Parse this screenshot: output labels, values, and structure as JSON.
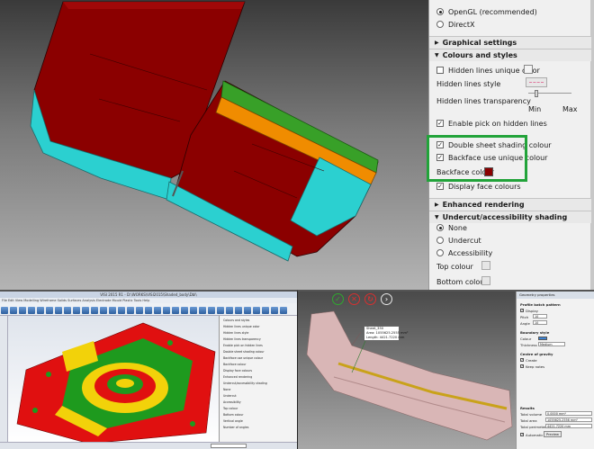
{
  "display": {
    "renderer_options": [
      {
        "label": "OpenGL (recommended)",
        "selected": true
      },
      {
        "label": "DirectX",
        "selected": false
      }
    ]
  },
  "sections": {
    "graphical": "Graphical settings",
    "colours": "Colours and styles",
    "enhanced": "Enhanced rendering",
    "undercut": "Undercut/accessibility shading"
  },
  "colours": {
    "hidden_unique": {
      "label": "Hidden lines unique color",
      "checked": false
    },
    "hidden_style": "Hidden lines style",
    "hidden_transparency": "Hidden lines transparency",
    "slider_min": "Min",
    "slider_max": "Max",
    "slider_value": 0.15,
    "pick_hidden": {
      "label": "Enable pick on hidden lines",
      "checked": true
    },
    "double_sheet": {
      "label": "Double sheet shading colour",
      "checked": true
    },
    "backface_unique": {
      "label": "Backface use unique colour",
      "checked": true
    },
    "backface_colour_label": "Backface colour",
    "backface_colour": "#8b0000",
    "display_face": {
      "label": "Display face colours",
      "checked": true
    }
  },
  "undercut": {
    "options": [
      {
        "label": "None",
        "selected": true
      },
      {
        "label": "Undercut",
        "selected": false
      },
      {
        "label": "Accessibility",
        "selected": false
      }
    ],
    "top_colour": "Top colour",
    "bottom_colour": "Bottom colour"
  },
  "cad_window": {
    "title": "VISI 2015 R1 - D:\\WORKS\\VISI2015\\Shaded_body\\Dbl\\",
    "menu": "File Edit View Modelling Wireframe Solids Surfaces Analysis Electrode Mould Plastic Tools Help",
    "mini_panel_lines": [
      "Colours and styles",
      "Hidden lines unique color",
      "Hidden lines style",
      "Hidden lines transparency",
      "Enable pick on hidden lines",
      "Double sheet shading colour",
      "Backface use unique colour",
      "Backface colour",
      "Display face colours",
      "Enhanced rendering",
      "Undercut/accessibility shading",
      "None",
      "Undercut",
      "Accessibility",
      "Top colour",
      "Bottom colour",
      "Vertical angle",
      "Number of angles"
    ]
  },
  "measure": {
    "tooltip_lines": [
      "Sheet_350",
      "Area: 1055625.2555 mm²",
      "Length: 4421.7220 mm"
    ],
    "panel_title": "Geometry properties",
    "profile_section": "Profile batch pattern",
    "display_label": "Display",
    "pitch_label": "Pitch",
    "pitch_value": "10",
    "angle_label": "Angle",
    "angle_value": "10",
    "boundary_section": "Boundary style",
    "colour_label": "Colour",
    "thickness_label": "Thickness",
    "thickness_value": "Medium",
    "gravity_section": "Centre of gravity",
    "create_label": "Create",
    "keep_label": "Keep notes",
    "results_section": "Results",
    "total_volume_label": "Total volume",
    "total_volume_value": "0.0000 mm³",
    "total_area_label": "Total area",
    "total_area_value": "1055625.2556 mm²",
    "total_perimeter_label": "Total perimeter",
    "total_perimeter_value": "4421.7220 mm",
    "automatic_label": "Automatic",
    "preview_label": "Preview"
  }
}
